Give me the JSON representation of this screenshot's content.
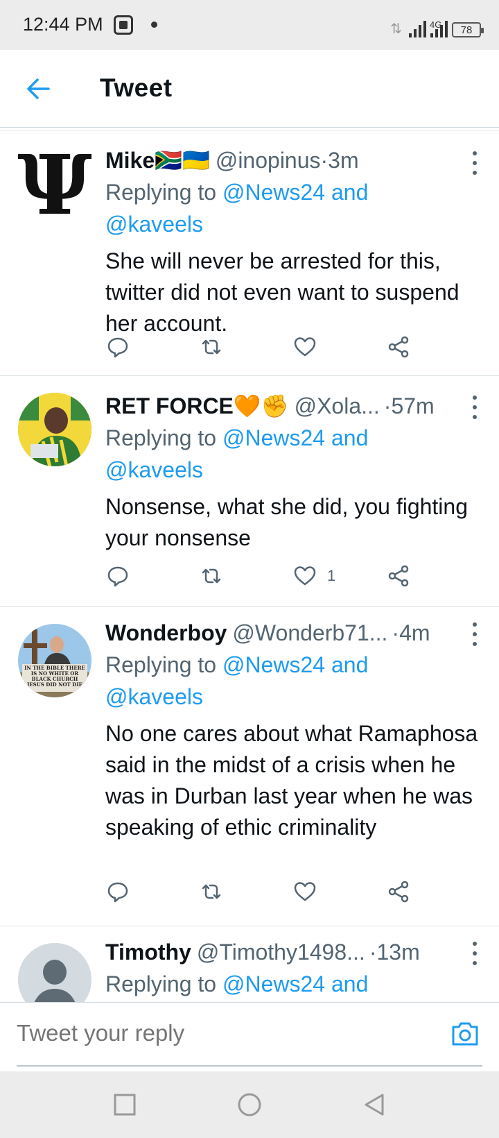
{
  "status_bar": {
    "time": "12:44 PM",
    "network": "4G",
    "battery": "78"
  },
  "header": {
    "title": "Tweet",
    "back_icon": "arrow-left-icon"
  },
  "tweets": [
    {
      "name": "Mike",
      "flags": "🇿🇦🇺🇦",
      "handle": "@inopinus",
      "separator": " · ",
      "time": "3m",
      "replying_label": "Replying to",
      "replying_to": "@News24 and @kaveels",
      "text": "She will never be arrested for this, twitter did not even want to suspend her account.",
      "likes": ""
    },
    {
      "name": "RET FORCE",
      "flags": "🧡✊",
      "handle": "@Xola...",
      "separator": " · ",
      "time": "57m",
      "replying_label": "Replying to",
      "replying_to": "@News24 and @kaveels",
      "text": "Nonsense, what she did, you fighting your nonsense",
      "likes": "1"
    },
    {
      "name": "Wonderboy",
      "flags": "",
      "handle": "@Wonderb71...",
      "separator": " · ",
      "time": "4m",
      "replying_label": "Replying to",
      "replying_to": "@News24 and @kaveels",
      "text": "No one cares about what Ramaphosa said in the midst of a crisis when he was in Durban last year when he was speaking of ethic criminality",
      "avatar_sign": "IN THE BIBLE THERE IS NO WHITE OR BLACK CHURCH JESUS DID NOT DIE TO SAVE SKIN",
      "likes": ""
    },
    {
      "name": "Timothy",
      "flags": "",
      "handle": "@Timothy1498...",
      "separator": " · ",
      "time": "13m",
      "replying_label": "Replying to",
      "replying_to": "@News24 and",
      "text": "",
      "likes": ""
    }
  ],
  "reply_bar": {
    "placeholder": "Tweet your reply"
  },
  "colors": {
    "accent": "#1d9bf0",
    "text": "#0f1419",
    "muted": "#536471",
    "status_bar_bg": "#ececec"
  }
}
